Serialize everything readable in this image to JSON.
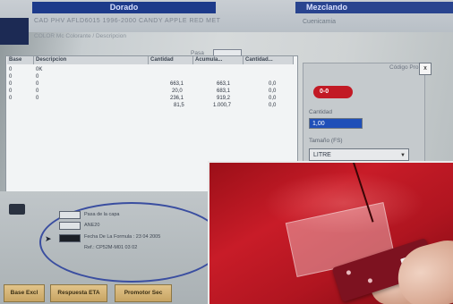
{
  "header": {
    "title_left": "Dorado",
    "title_right": "Mezclando",
    "code_line": "CAD   PHV     AFLD6015    1996-2000    CANDY APPLE RED MET",
    "sub_line": "COLOR Mc        Colorante / Descripcion",
    "side_text": "Cuenicamia"
  },
  "code_field": {
    "label": "Pasa"
  },
  "table": {
    "headers": [
      "Base",
      "Descripcion",
      "Cantidad",
      "Acumula...",
      "Cantidad..."
    ],
    "rows": [
      [
        "0",
        "0K",
        "",
        "",
        ""
      ],
      [
        "0",
        "0",
        "",
        "",
        ""
      ],
      [
        "0",
        "0",
        "663,1",
        "663,1",
        "0,0"
      ],
      [
        "0",
        "0",
        "20,0",
        "683,1",
        "0,0"
      ],
      [
        "0",
        "0",
        "236,1",
        "919,2",
        "0,0"
      ],
      [
        "",
        "",
        "81,5",
        "1.000,7",
        "0,0"
      ]
    ]
  },
  "right_panel": {
    "chip_label": "0-0",
    "label_qty": "Cantidad",
    "qty_value": "1,00",
    "label_size": "Tamaño (FS)",
    "size_value": "LITRE",
    "right_label": "Código Pro",
    "check_value": "x"
  },
  "bottom": {
    "legend": [
      "Pasa de la capa",
      "ANE20",
      "Fecha De La Formula : 23 04 2005",
      "Ref.: CP52M-M01 03 02"
    ]
  },
  "buttons": [
    "Base Excl",
    "Respuesta ETA",
    "Promotor Sec"
  ],
  "colors": {
    "title_blue": "#1d3a8a",
    "car_red": "#c81c28",
    "oval_blue": "#3a4ea0"
  }
}
